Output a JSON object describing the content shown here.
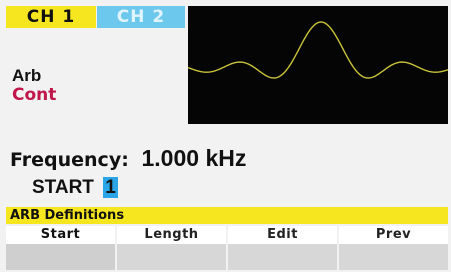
{
  "channels": {
    "ch1_label": "CH 1",
    "ch2_label": "CH 2",
    "ch1_color": "#f5e61f",
    "ch2_color": "#6dc8ee"
  },
  "waveform": {
    "name": "Arb",
    "mode": "Cont",
    "mode_color": "#c0164a",
    "trace_color": "#c9c23a"
  },
  "frequency": {
    "label": "Frequency:",
    "value": "1.000 kHz"
  },
  "start": {
    "label": "START",
    "value": "1"
  },
  "definitions_bar": {
    "title": "ARB Definitions"
  },
  "softkeys": [
    {
      "label": "Start"
    },
    {
      "label": "Length"
    },
    {
      "label": "Edit"
    },
    {
      "label": "Prev"
    }
  ]
}
